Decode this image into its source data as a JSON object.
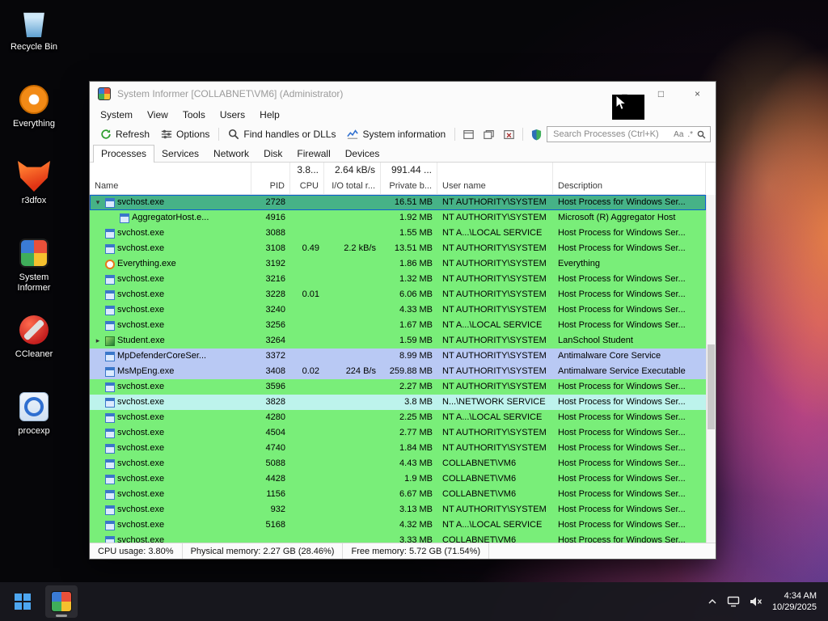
{
  "colors": {
    "row_green": "#79ee79",
    "row_lavender": "#b9c9f4",
    "row_cyan": "#bdf3ec",
    "row_selected": "#46b287",
    "selection_border": "#0b5fd0",
    "accent_refresh": "#2e9e2e",
    "taskbar_bg": "#18181e"
  },
  "desktop": {
    "icons": [
      {
        "label": "Recycle Bin",
        "key": "recycle-bin"
      },
      {
        "label": "Everything",
        "key": "everything"
      },
      {
        "label": "r3dfox",
        "key": "r3dfox"
      },
      {
        "label": "System Informer",
        "key": "system-informer"
      },
      {
        "label": "CCleaner",
        "key": "ccleaner"
      },
      {
        "label": "procexp",
        "key": "procexp"
      }
    ]
  },
  "window": {
    "title": "System Informer [COLLABNET\\VM6] (Administrator)",
    "window_buttons": {
      "minimize": "–",
      "maximize": "□",
      "close": "×"
    },
    "menu": [
      "System",
      "View",
      "Tools",
      "Users",
      "Help"
    ],
    "toolbar": {
      "buttons": [
        {
          "label": "Refresh"
        },
        {
          "label": "Options"
        },
        {
          "label": "Find handles or DLLs"
        },
        {
          "label": "System information"
        }
      ],
      "search": {
        "placeholder": "Search Processes (Ctrl+K)",
        "match_case": "Aa",
        "regex": ".*"
      }
    },
    "tabs": [
      {
        "label": "Processes",
        "selected": true
      },
      {
        "label": "Services",
        "selected": false
      },
      {
        "label": "Network",
        "selected": false
      },
      {
        "label": "Disk",
        "selected": false
      },
      {
        "label": "Firewall",
        "selected": false
      },
      {
        "label": "Devices",
        "selected": false
      }
    ],
    "columns": {
      "headers": [
        "Name",
        "PID",
        "CPU",
        "I/O total r...",
        "Private b...",
        "User name",
        "Description"
      ],
      "totals": {
        "cpu": "3.8...",
        "io": "2.64 kB/s",
        "private": "991.44 ..."
      }
    },
    "processes": [
      {
        "name": "svchost.exe",
        "pid": "2728",
        "cpu": "",
        "io": "",
        "private": "16.51 MB",
        "user": "NT AUTHORITY\\SYSTEM",
        "desc": "Host Process for Windows Ser...",
        "color": "green",
        "indent": 1,
        "arrow": "down",
        "icon": "window",
        "selected": true
      },
      {
        "name": "AggregatorHost.e...",
        "pid": "4916",
        "cpu": "",
        "io": "",
        "private": "1.92 MB",
        "user": "NT AUTHORITY\\SYSTEM",
        "desc": "Microsoft (R) Aggregator Host",
        "color": "green",
        "indent": 2,
        "arrow": "",
        "icon": "window",
        "selected": false
      },
      {
        "name": "svchost.exe",
        "pid": "3088",
        "cpu": "",
        "io": "",
        "private": "1.55 MB",
        "user": "NT A...\\LOCAL SERVICE",
        "desc": "Host Process for Windows Ser...",
        "color": "green",
        "indent": 1,
        "arrow": "",
        "icon": "window",
        "selected": false
      },
      {
        "name": "svchost.exe",
        "pid": "3108",
        "cpu": "0.49",
        "io": "2.2 kB/s",
        "private": "13.51 MB",
        "user": "NT AUTHORITY\\SYSTEM",
        "desc": "Host Process for Windows Ser...",
        "color": "green",
        "indent": 1,
        "arrow": "",
        "icon": "window",
        "selected": false
      },
      {
        "name": "Everything.exe",
        "pid": "3192",
        "cpu": "",
        "io": "",
        "private": "1.86 MB",
        "user": "NT AUTHORITY\\SYSTEM",
        "desc": "Everything",
        "color": "green",
        "indent": 1,
        "arrow": "",
        "icon": "everything",
        "selected": false
      },
      {
        "name": "svchost.exe",
        "pid": "3216",
        "cpu": "",
        "io": "",
        "private": "1.32 MB",
        "user": "NT AUTHORITY\\SYSTEM",
        "desc": "Host Process for Windows Ser...",
        "color": "green",
        "indent": 1,
        "arrow": "",
        "icon": "window",
        "selected": false
      },
      {
        "name": "svchost.exe",
        "pid": "3228",
        "cpu": "0.01",
        "io": "",
        "private": "6.06 MB",
        "user": "NT AUTHORITY\\SYSTEM",
        "desc": "Host Process for Windows Ser...",
        "color": "green",
        "indent": 1,
        "arrow": "",
        "icon": "window",
        "selected": false
      },
      {
        "name": "svchost.exe",
        "pid": "3240",
        "cpu": "",
        "io": "",
        "private": "4.33 MB",
        "user": "NT AUTHORITY\\SYSTEM",
        "desc": "Host Process for Windows Ser...",
        "color": "green",
        "indent": 1,
        "arrow": "",
        "icon": "window",
        "selected": false
      },
      {
        "name": "svchost.exe",
        "pid": "3256",
        "cpu": "",
        "io": "",
        "private": "1.67 MB",
        "user": "NT A...\\LOCAL SERVICE",
        "desc": "Host Process for Windows Ser...",
        "color": "green",
        "indent": 1,
        "arrow": "",
        "icon": "window",
        "selected": false
      },
      {
        "name": "Student.exe",
        "pid": "3264",
        "cpu": "",
        "io": "",
        "private": "1.59 MB",
        "user": "NT AUTHORITY\\SYSTEM",
        "desc": "LanSchool Student",
        "color": "green",
        "indent": 1,
        "arrow": "right",
        "icon": "student",
        "selected": false
      },
      {
        "name": "MpDefenderCoreSer...",
        "pid": "3372",
        "cpu": "",
        "io": "",
        "private": "8.99 MB",
        "user": "NT AUTHORITY\\SYSTEM",
        "desc": "Antimalware Core Service",
        "color": "lavender",
        "indent": 1,
        "arrow": "",
        "icon": "window",
        "selected": false
      },
      {
        "name": "MsMpEng.exe",
        "pid": "3408",
        "cpu": "0.02",
        "io": "224 B/s",
        "private": "259.88 MB",
        "user": "NT AUTHORITY\\SYSTEM",
        "desc": "Antimalware Service Executable",
        "color": "lavender",
        "indent": 1,
        "arrow": "",
        "icon": "window",
        "selected": false
      },
      {
        "name": "svchost.exe",
        "pid": "3596",
        "cpu": "",
        "io": "",
        "private": "2.27 MB",
        "user": "NT AUTHORITY\\SYSTEM",
        "desc": "Host Process for Windows Ser...",
        "color": "green",
        "indent": 1,
        "arrow": "",
        "icon": "window",
        "selected": false
      },
      {
        "name": "svchost.exe",
        "pid": "3828",
        "cpu": "",
        "io": "",
        "private": "3.8 MB",
        "user": "N...\\NETWORK SERVICE",
        "desc": "Host Process for Windows Ser...",
        "color": "cyan",
        "indent": 1,
        "arrow": "",
        "icon": "window",
        "selected": false
      },
      {
        "name": "svchost.exe",
        "pid": "4280",
        "cpu": "",
        "io": "",
        "private": "2.25 MB",
        "user": "NT A...\\LOCAL SERVICE",
        "desc": "Host Process for Windows Ser...",
        "color": "green",
        "indent": 1,
        "arrow": "",
        "icon": "window",
        "selected": false
      },
      {
        "name": "svchost.exe",
        "pid": "4504",
        "cpu": "",
        "io": "",
        "private": "2.77 MB",
        "user": "NT AUTHORITY\\SYSTEM",
        "desc": "Host Process for Windows Ser...",
        "color": "green",
        "indent": 1,
        "arrow": "",
        "icon": "window",
        "selected": false
      },
      {
        "name": "svchost.exe",
        "pid": "4740",
        "cpu": "",
        "io": "",
        "private": "1.84 MB",
        "user": "NT AUTHORITY\\SYSTEM",
        "desc": "Host Process for Windows Ser...",
        "color": "green",
        "indent": 1,
        "arrow": "",
        "icon": "window",
        "selected": false
      },
      {
        "name": "svchost.exe",
        "pid": "5088",
        "cpu": "",
        "io": "",
        "private": "4.43 MB",
        "user": "COLLABNET\\VM6",
        "desc": "Host Process for Windows Ser...",
        "color": "green",
        "indent": 1,
        "arrow": "",
        "icon": "window",
        "selected": false
      },
      {
        "name": "svchost.exe",
        "pid": "4428",
        "cpu": "",
        "io": "",
        "private": "1.9 MB",
        "user": "COLLABNET\\VM6",
        "desc": "Host Process for Windows Ser...",
        "color": "green",
        "indent": 1,
        "arrow": "",
        "icon": "window",
        "selected": false
      },
      {
        "name": "svchost.exe",
        "pid": "1156",
        "cpu": "",
        "io": "",
        "private": "6.67 MB",
        "user": "COLLABNET\\VM6",
        "desc": "Host Process for Windows Ser...",
        "color": "green",
        "indent": 1,
        "arrow": "",
        "icon": "window",
        "selected": false
      },
      {
        "name": "svchost.exe",
        "pid": "932",
        "cpu": "",
        "io": "",
        "private": "3.13 MB",
        "user": "NT AUTHORITY\\SYSTEM",
        "desc": "Host Process for Windows Ser...",
        "color": "green",
        "indent": 1,
        "arrow": "",
        "icon": "window",
        "selected": false
      },
      {
        "name": "svchost.exe",
        "pid": "5168",
        "cpu": "",
        "io": "",
        "private": "4.32 MB",
        "user": "NT A...\\LOCAL SERVICE",
        "desc": "Host Process for Windows Ser...",
        "color": "green",
        "indent": 1,
        "arrow": "",
        "icon": "window",
        "selected": false
      },
      {
        "name": "svchost.exe",
        "pid": "",
        "cpu": "",
        "io": "",
        "private": "3.33 MB",
        "user": "COLLABNET\\VM6",
        "desc": "Host Process for Windows Ser...",
        "color": "green",
        "indent": 1,
        "arrow": "",
        "icon": "window",
        "selected": false
      }
    ],
    "statusbar": [
      "CPU usage: 3.80%",
      "Physical memory: 2.27 GB (28.46%)",
      "Free memory: 5.72 GB (71.54%)"
    ]
  },
  "taskbar": {
    "time": "4:34 AM",
    "date": "10/29/2025"
  }
}
